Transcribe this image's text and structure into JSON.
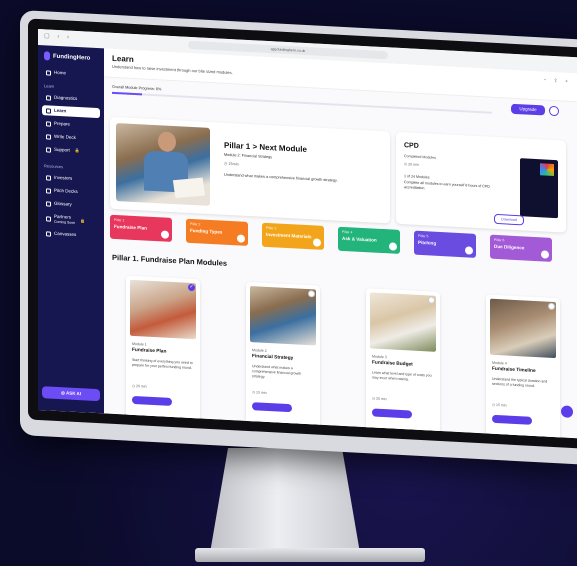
{
  "app": {
    "logo": "FundingHero"
  },
  "browser": {
    "url": "app.fundinghero.co.uk"
  },
  "sidebar": {
    "home": "Home",
    "section_learn": "Learn",
    "items": [
      {
        "label": "Diagnostics"
      },
      {
        "label": "Learn"
      },
      {
        "label": "Prepare"
      },
      {
        "label": "Write Deck"
      },
      {
        "label": "Support"
      }
    ],
    "section_resources": "Resources",
    "resources": [
      {
        "label": "Investors"
      },
      {
        "label": "Pitch Decks"
      },
      {
        "label": "Glossary"
      },
      {
        "label": "Partners",
        "sub": "Coming Soon"
      },
      {
        "label": "Canvasses"
      }
    ],
    "ask_ai": "ASK AI"
  },
  "header": {
    "title": "Learn",
    "subtitle": "Understand how to raise investment through our bite sized modules.",
    "progress_label": "Overall Module Progress: 8%",
    "progress_percent": 8,
    "upgrade": "Upgrade"
  },
  "next_module": {
    "title": "Pillar 1 > Next Module",
    "subtitle": "Module 2: Financial Strategy",
    "time": "15min",
    "description": "Understand what makes a comprehensive financial growth strategy."
  },
  "cpd": {
    "title": "CPD",
    "completed_label": "Completed Modules",
    "time": "20 min",
    "count": "1 of 24 Modules",
    "description": "Complete all modules to earn yourself 8 hours of CPD accreditation.",
    "button": "Download"
  },
  "pillars": [
    {
      "num": "Pillar 1",
      "title": "Fundraise Plan",
      "color": "#e8375d"
    },
    {
      "num": "Pillar 2",
      "title": "Funding Types",
      "color": "#f57c22"
    },
    {
      "num": "Pillar 3",
      "title": "Investment Materials",
      "color": "#f2a51a"
    },
    {
      "num": "Pillar 4",
      "title": "Ask & Valuation",
      "color": "#22b47a"
    },
    {
      "num": "Pillar 5",
      "title": "Pitching",
      "color": "#6a4ce0"
    },
    {
      "num": "Pillar 6",
      "title": "Due Diligence",
      "color": "#a35ad6"
    }
  ],
  "modules_section": {
    "title": "Pillar 1. Fundraise Plan Modules"
  },
  "modules": [
    {
      "num": "Module 1",
      "title": "Fundraise Plan",
      "desc": "Start thinking of everything you need to prepare for your perfect funding round.",
      "time": "20 min",
      "done": true
    },
    {
      "num": "Module 2",
      "title": "Financial Strategy",
      "desc": "Understand what makes a comprehensive financial growth strategy.",
      "time": "15 min",
      "done": false
    },
    {
      "num": "Module 3",
      "title": "Fundraise Budget",
      "desc": "Learn what level and type of costs you may incur when raising.",
      "time": "20 min",
      "done": false
    },
    {
      "num": "Module 4",
      "title": "Fundraise Timeline",
      "desc": "Understand the typical duration and sections of a funding round.",
      "time": "15 min",
      "done": false
    }
  ]
}
